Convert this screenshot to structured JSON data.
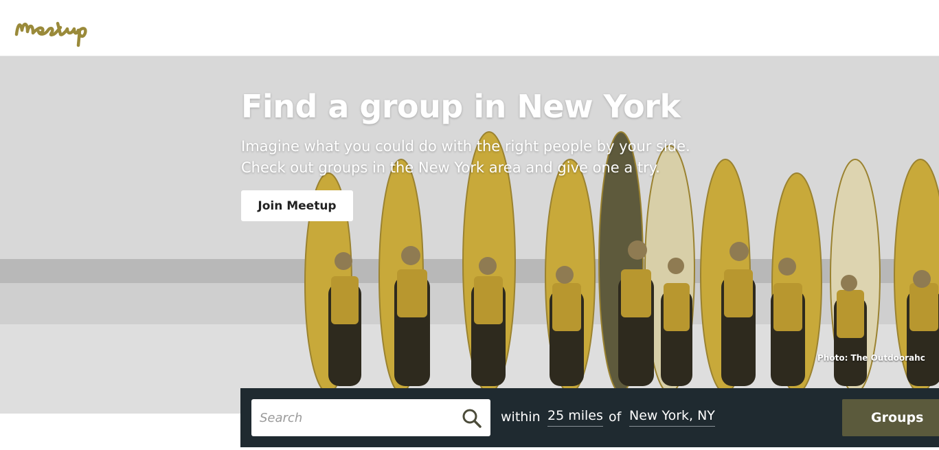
{
  "header": {
    "logo_text": "Meetup",
    "logo_color": "#9a8a3a"
  },
  "hero": {
    "title": "Find a group in New York",
    "subtitle_line1": "Imagine what you could do with the right people by your side.",
    "subtitle_line2": "Check out groups in the New York area and give one a try.",
    "join_label": "Join Meetup",
    "photo_credit": "Photo: The Outdoorahc"
  },
  "search": {
    "placeholder": "Search",
    "icon": "search-icon",
    "within_label": "within",
    "radius_value": "25 miles",
    "of_label": "of",
    "location_value": "New York, NY",
    "groups_label": "Groups"
  },
  "colors": {
    "accent_olive": "#5b5a3c",
    "search_bar_bg": "#1f2a30",
    "surfboard_gold": "#c8a93a"
  }
}
